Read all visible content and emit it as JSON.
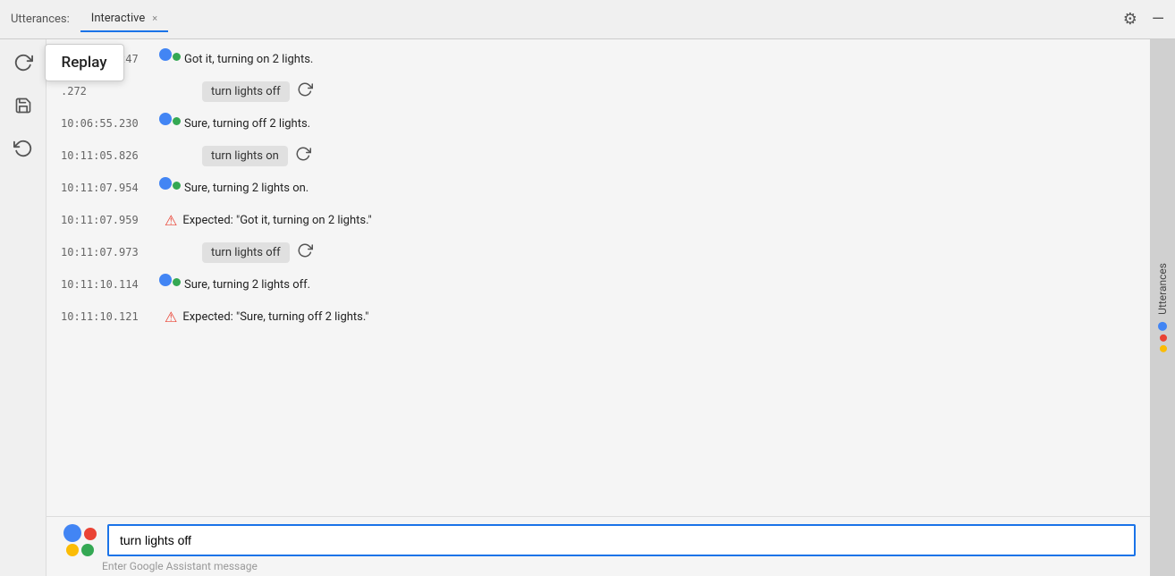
{
  "titleBar": {
    "label": "Utterances:",
    "tab": "Interactive",
    "tabCloseLabel": "×",
    "settingsIcon": "⚙",
    "minimizeIcon": "—"
  },
  "sidebar": {
    "replayIcon": "↺",
    "replayTooltip": "Replay",
    "saveIcon": "💾",
    "undoIcon": "↩"
  },
  "messages": [
    {
      "id": 1,
      "timestamp": "10:04:36.247",
      "type": "assistant",
      "text": "Got it, turning on 2 lights."
    },
    {
      "id": 2,
      "timestamp": ".272",
      "type": "user-input",
      "text": "turn lights off"
    },
    {
      "id": 3,
      "timestamp": "10:06:55.230",
      "type": "assistant",
      "text": "Sure, turning off 2 lights."
    },
    {
      "id": 4,
      "timestamp": "10:11:05.826",
      "type": "user-input",
      "text": "turn lights on"
    },
    {
      "id": 5,
      "timestamp": "10:11:07.954",
      "type": "assistant",
      "text": "Sure, turning 2 lights on."
    },
    {
      "id": 6,
      "timestamp": "10:11:07.959",
      "type": "error",
      "text": "Expected: \"Got it, turning on 2 lights.\""
    },
    {
      "id": 7,
      "timestamp": "10:11:07.973",
      "type": "user-input",
      "text": "turn lights off"
    },
    {
      "id": 8,
      "timestamp": "10:11:10.114",
      "type": "assistant",
      "text": "Sure, turning 2 lights off."
    },
    {
      "id": 9,
      "timestamp": "10:11:10.121",
      "type": "error",
      "text": "Expected: \"Sure, turning off 2 lights.\""
    }
  ],
  "inputArea": {
    "value": "turn lights off",
    "placeholder": "Enter Google Assistant message"
  },
  "rightSidebar": {
    "label": "Utterances"
  }
}
